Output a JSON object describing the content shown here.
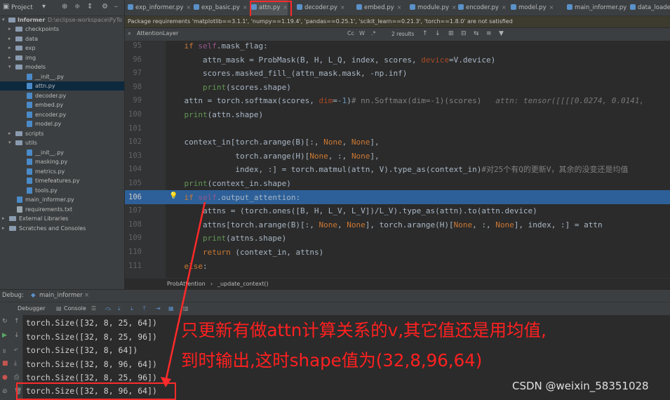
{
  "project": {
    "title": "Project",
    "root_name": "Informer",
    "root_path": "D:\\eclipse-workspace\\PyTo",
    "items": [
      {
        "label": "checkpoints",
        "type": "folder",
        "depth": 1
      },
      {
        "label": "data",
        "type": "folder",
        "depth": 1
      },
      {
        "label": "exp",
        "type": "folder",
        "depth": 1
      },
      {
        "label": "img",
        "type": "folder",
        "depth": 1
      },
      {
        "label": "models",
        "type": "folder",
        "depth": 1,
        "open": true
      },
      {
        "label": "__init__.py",
        "type": "py",
        "depth": 2
      },
      {
        "label": "attn.py",
        "type": "py",
        "depth": 2,
        "selected": true
      },
      {
        "label": "decoder.py",
        "type": "py",
        "depth": 2
      },
      {
        "label": "embed.py",
        "type": "py",
        "depth": 2
      },
      {
        "label": "encoder.py",
        "type": "py",
        "depth": 2
      },
      {
        "label": "model.py",
        "type": "py",
        "depth": 2
      },
      {
        "label": "scripts",
        "type": "folder",
        "depth": 1
      },
      {
        "label": "utils",
        "type": "folder",
        "depth": 1,
        "open": true
      },
      {
        "label": "__init__.py",
        "type": "py",
        "depth": 2
      },
      {
        "label": "masking.py",
        "type": "py",
        "depth": 2
      },
      {
        "label": "metrics.py",
        "type": "py",
        "depth": 2
      },
      {
        "label": "timefeatures.py",
        "type": "py",
        "depth": 2
      },
      {
        "label": "tools.py",
        "type": "py",
        "depth": 2
      },
      {
        "label": "main_informer.py",
        "type": "py",
        "depth": 1
      },
      {
        "label": "requirements.txt",
        "type": "txt",
        "depth": 1
      },
      {
        "label": "External Libraries",
        "type": "lib",
        "depth": 0
      },
      {
        "label": "Scratches and Consoles",
        "type": "scratch",
        "depth": 0
      }
    ]
  },
  "tabs": [
    "exp_informer.py",
    "exp_basic.py",
    "attn.py",
    "decoder.py",
    "embed.py",
    "module.py",
    "encoder.py",
    "model.py",
    "main_informer.py",
    "data_loade"
  ],
  "active_tab": "attn.py",
  "banner": "Package requirements 'matplotlib==3.1.1', 'numpy==1.19.4', 'pandas==0.25.1', 'scikit_learn==0.21.3', 'torch==1.8.0' are not satisfied",
  "search": {
    "value": "AttentionLayer",
    "results": "2 results"
  },
  "code": {
    "line_numbers": [
      "95",
      "96",
      "97",
      "98",
      "99",
      "100",
      "101",
      "102",
      "103",
      "104",
      "105",
      "106",
      "107",
      "108",
      "109",
      "110",
      "111"
    ],
    "current_line": "106"
  },
  "breadcrumb": {
    "a": "ProbAttention",
    "sep": "›",
    "b": "_update_context()"
  },
  "debug": {
    "label": "Debug:",
    "config": "main_informer",
    "tab_debugger": "Debugger",
    "tab_console": "Console"
  },
  "console_lines": [
    "torch.Size([32, 8, 25, 64])",
    "torch.Size([32, 8, 25, 96])",
    "torch.Size([32, 8, 64])",
    "torch.Size([32, 8, 96, 64])",
    "torch.Size([32, 8, 25, 96])",
    "torch.Size([32, 8, 96, 64])"
  ],
  "annotation": {
    "line1": "只更新有做attn计算关系的v,其它值还是用均值,",
    "line2": "到时输出,这时shape值为(32,8,96,64)"
  },
  "watermark": "CSDN @weixin_58351028",
  "colors": {
    "annotation": "#ff2020",
    "highlight": "#2d6099"
  }
}
